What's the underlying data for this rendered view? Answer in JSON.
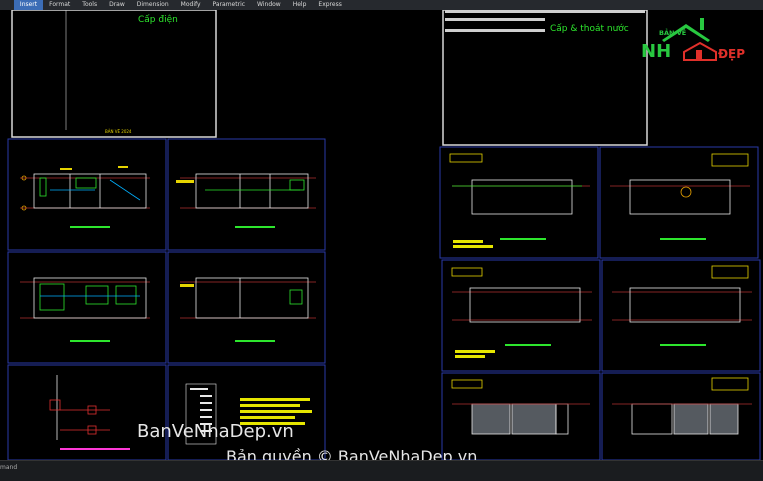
{
  "menu": {
    "items": [
      "Insert",
      "Format",
      "Tools",
      "Draw",
      "Dimension",
      "Modify",
      "Parametric",
      "Window",
      "Help",
      "Express"
    ],
    "active": "Insert"
  },
  "titles": {
    "electric": "Cấp điện",
    "water": "Cấp & thoát nước"
  },
  "cover_small_text": "BẢN VẼ 2024",
  "logo": {
    "line1": "BẢN VẼ",
    "line2": "NH",
    "line3": "ĐẸP"
  },
  "watermarks": {
    "mid": "BanVeNhaDep.vn",
    "bottom": "Bản quyền © BanVeNhaDep.vn"
  },
  "status": {
    "text": "mand"
  },
  "colors": {
    "accent": "#3c6db6",
    "frame": "#2a3aa8",
    "title_green": "#2de62d",
    "logo_green": "#28c840",
    "logo_red": "#e0302a"
  }
}
